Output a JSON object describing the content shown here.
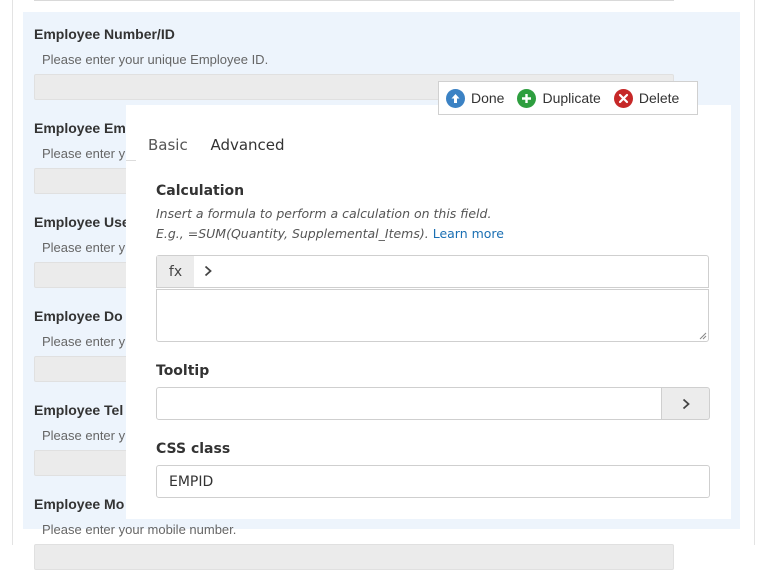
{
  "form": {
    "fields": [
      {
        "label": "Employee Number/ID",
        "help": "Please enter your unique Employee ID."
      },
      {
        "label": "Employee Em",
        "help": "Please enter y"
      },
      {
        "label": "Employee Use",
        "help": "Please enter y"
      },
      {
        "label": "Employee Do",
        "help": "Please enter y"
      },
      {
        "label": "Employee Tel",
        "help": "Please enter y"
      },
      {
        "label": "Employee Mo",
        "help": "Please enter your mobile number."
      }
    ]
  },
  "actions": {
    "done": "Done",
    "duplicate": "Duplicate",
    "delete": "Delete"
  },
  "tabs": {
    "basic": "Basic",
    "advanced": "Advanced"
  },
  "calculation": {
    "label": "Calculation",
    "desc_line1": "Insert a formula to perform a calculation on this field.",
    "desc_line2": "E.g., =SUM(Quantity, Supplemental_Items).",
    "learn_more": "Learn more",
    "fx": "fx",
    "formula_value": ""
  },
  "tooltip": {
    "label": "Tooltip",
    "value": ""
  },
  "css_class": {
    "label": "CSS class",
    "value": "EMPID"
  },
  "colors": {
    "accent": "#2bab8e",
    "selected_bg": "#edf4fc",
    "done_icon": "#3b82c4",
    "duplicate_icon": "#2e9e3f",
    "delete_icon": "#c62828",
    "link": "#1a6fb3"
  },
  "icons": {
    "done": "arrow-up-circle-icon",
    "duplicate": "plus-circle-icon",
    "delete": "close-circle-icon",
    "chevron": "chevron-right-icon"
  }
}
